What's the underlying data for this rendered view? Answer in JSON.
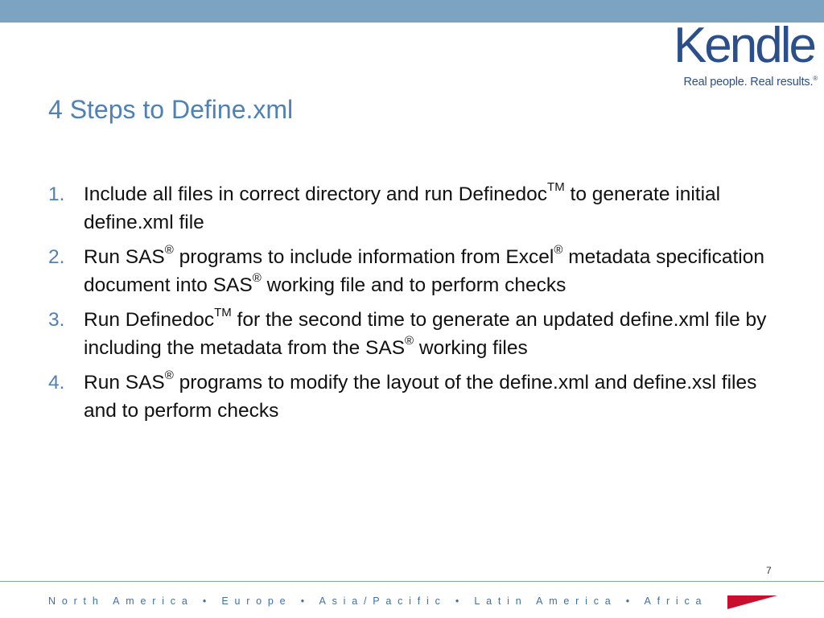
{
  "brand": {
    "name": "Kendle",
    "tagline": "Real people. Real results.",
    "tagline_mark": "®",
    "color": "#2b4f8b",
    "accent": "#c8102e"
  },
  "slide": {
    "title": "4 Steps to Define.xml",
    "steps": [
      {
        "number": "1.",
        "parts": [
          "Include all files in correct directory and run Definedoc",
          "TM",
          " to generate initial define.xml file"
        ]
      },
      {
        "number": "2.",
        "parts": [
          "Run SAS",
          "®",
          " programs to include information from Excel",
          "®",
          " metadata specification document into SAS",
          "®",
          " working file and to perform checks"
        ]
      },
      {
        "number": "3.",
        "parts": [
          "Run Definedoc",
          "TM",
          " for the second time to generate an updated define.xml file by including the metadata from the SAS",
          "®",
          " working files"
        ]
      },
      {
        "number": "4.",
        "parts": [
          "Run SAS",
          "®",
          " programs to modify the layout of the define.xml and define.xsl files and to perform checks"
        ]
      }
    ],
    "page_number": "7"
  },
  "footer": {
    "regions": "North America • Europe • Asia/Pacific • Latin America • Africa"
  },
  "colors": {
    "header_bar": "#7da3c3",
    "title": "#4f81b5",
    "number": "#4f81b5",
    "body_text": "#111111"
  }
}
